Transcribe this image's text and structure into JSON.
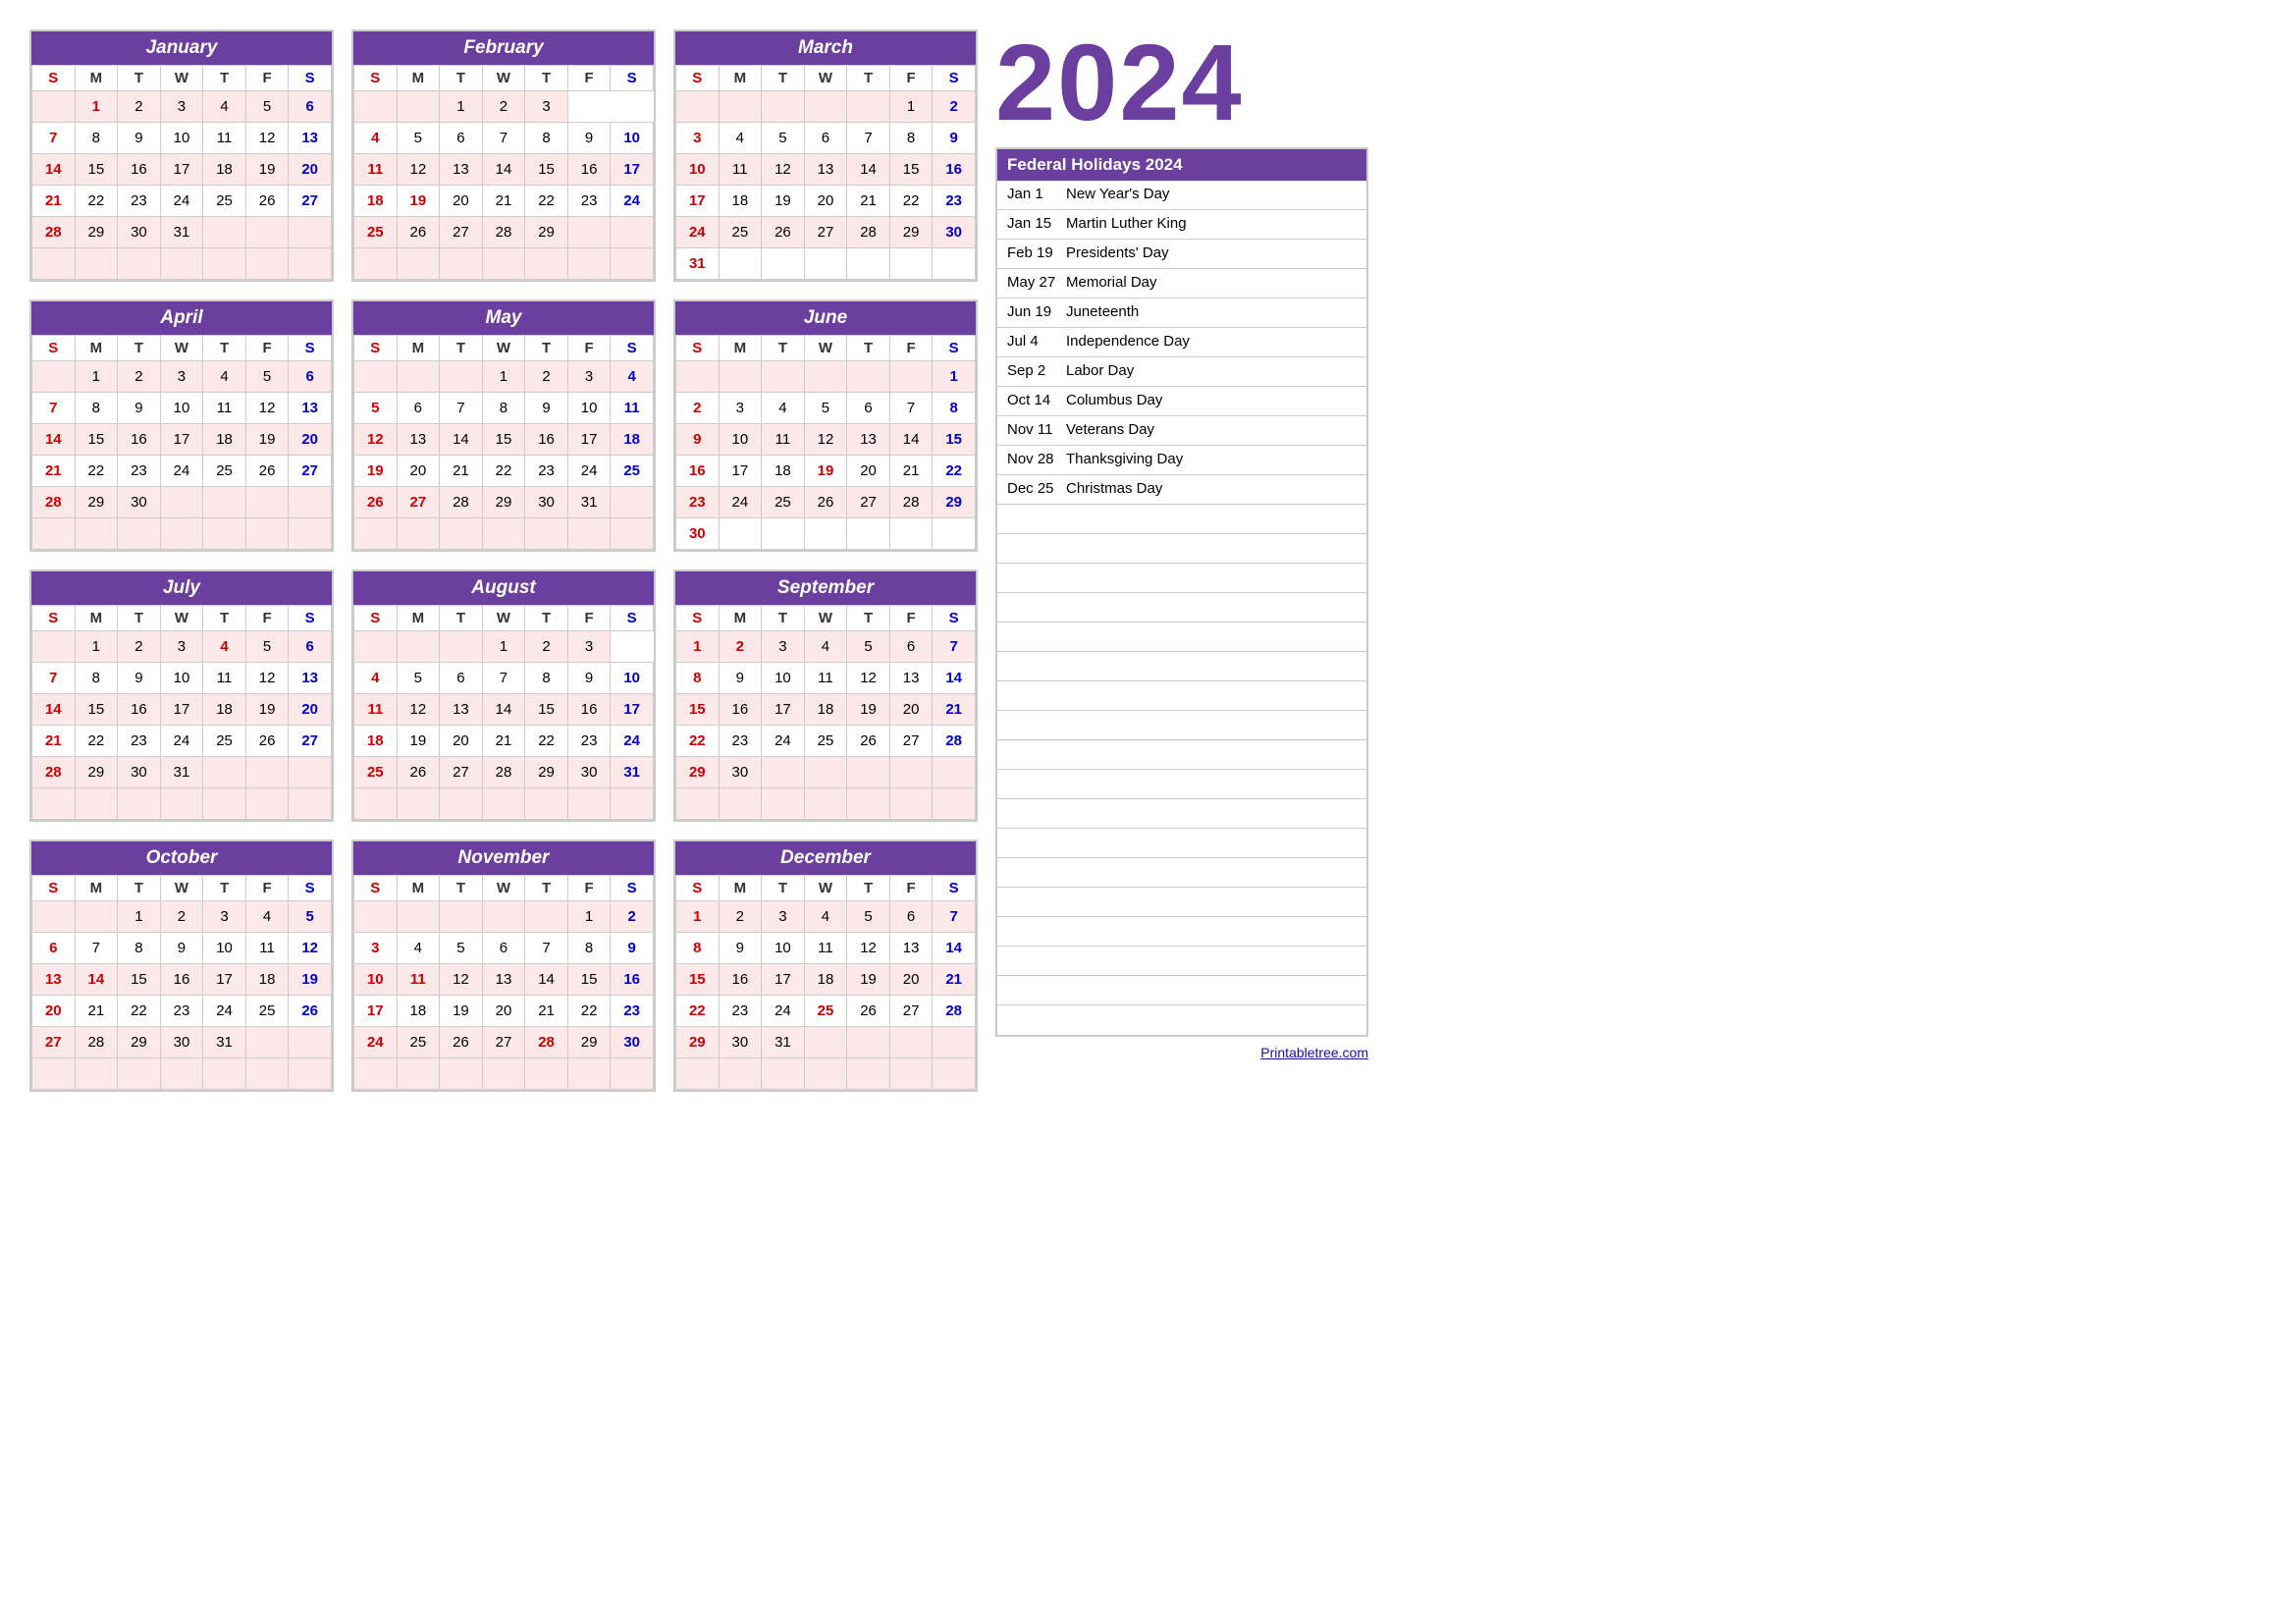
{
  "year": "2024",
  "holidays_header": "Federal Holidays 2024",
  "holidays": [
    {
      "date": "Jan 1",
      "name": "New Year's Day"
    },
    {
      "date": "Jan 15",
      "name": "Martin Luther King"
    },
    {
      "date": "Feb 19",
      "name": "Presidents' Day"
    },
    {
      "date": "May 27",
      "name": "Memorial Day"
    },
    {
      "date": "Jun 19",
      "name": "Juneteenth"
    },
    {
      "date": "Jul 4",
      "name": "Independence Day"
    },
    {
      "date": "Sep 2",
      "name": "Labor Day"
    },
    {
      "date": "Oct 14",
      "name": "Columbus Day"
    },
    {
      "date": "Nov 11",
      "name": "Veterans Day"
    },
    {
      "date": "Nov 28",
      "name": "Thanksgiving Day"
    },
    {
      "date": "Dec 25",
      "name": "Christmas Day"
    }
  ],
  "footer_link": "Printabletree.com",
  "months": [
    {
      "name": "January",
      "days": [
        [
          "",
          "1",
          "2",
          "3",
          "4",
          "5",
          "6"
        ],
        [
          "7",
          "8",
          "9",
          "10",
          "11",
          "12",
          "13"
        ],
        [
          "14",
          "15",
          "16",
          "17",
          "18",
          "19",
          "20"
        ],
        [
          "21",
          "22",
          "23",
          "24",
          "25",
          "26",
          "27"
        ],
        [
          "28",
          "29",
          "30",
          "31",
          "",
          "",
          ""
        ]
      ],
      "holidays": [
        "1"
      ]
    },
    {
      "name": "February",
      "days": [
        [
          "",
          "",
          "1",
          "2",
          "3"
        ],
        [
          "4",
          "5",
          "6",
          "7",
          "8",
          "9",
          "10"
        ],
        [
          "11",
          "12",
          "13",
          "14",
          "15",
          "16",
          "17"
        ],
        [
          "18",
          "19",
          "20",
          "21",
          "22",
          "23",
          "24"
        ],
        [
          "25",
          "26",
          "27",
          "28",
          "29",
          "",
          ""
        ]
      ],
      "holidays": [
        "19"
      ]
    },
    {
      "name": "March",
      "days": [
        [
          "",
          "",
          "",
          "",
          "",
          "1",
          "2"
        ],
        [
          "3",
          "4",
          "5",
          "6",
          "7",
          "8",
          "9"
        ],
        [
          "10",
          "11",
          "12",
          "13",
          "14",
          "15",
          "16"
        ],
        [
          "17",
          "18",
          "19",
          "20",
          "21",
          "22",
          "23"
        ],
        [
          "24",
          "25",
          "26",
          "27",
          "28",
          "29",
          "30"
        ],
        [
          "31",
          "",
          "",
          "",
          "",
          "",
          ""
        ]
      ],
      "holidays": []
    },
    {
      "name": "April",
      "days": [
        [
          "",
          "1",
          "2",
          "3",
          "4",
          "5",
          "6"
        ],
        [
          "7",
          "8",
          "9",
          "10",
          "11",
          "12",
          "13"
        ],
        [
          "14",
          "15",
          "16",
          "17",
          "18",
          "19",
          "20"
        ],
        [
          "21",
          "22",
          "23",
          "24",
          "25",
          "26",
          "27"
        ],
        [
          "28",
          "29",
          "30",
          "",
          "",
          "",
          ""
        ]
      ],
      "holidays": []
    },
    {
      "name": "May",
      "days": [
        [
          "",
          "",
          "",
          "1",
          "2",
          "3",
          "4"
        ],
        [
          "5",
          "6",
          "7",
          "8",
          "9",
          "10",
          "11"
        ],
        [
          "12",
          "13",
          "14",
          "15",
          "16",
          "17",
          "18"
        ],
        [
          "19",
          "20",
          "21",
          "22",
          "23",
          "24",
          "25"
        ],
        [
          "26",
          "27",
          "28",
          "29",
          "30",
          "31",
          ""
        ]
      ],
      "holidays": [
        "27"
      ]
    },
    {
      "name": "June",
      "days": [
        [
          "",
          "",
          "",
          "",
          "",
          "",
          "1"
        ],
        [
          "2",
          "3",
          "4",
          "5",
          "6",
          "7",
          "8"
        ],
        [
          "9",
          "10",
          "11",
          "12",
          "13",
          "14",
          "15"
        ],
        [
          "16",
          "17",
          "18",
          "19",
          "20",
          "21",
          "22"
        ],
        [
          "23",
          "24",
          "25",
          "26",
          "27",
          "28",
          "29"
        ],
        [
          "30",
          "",
          "",
          "",
          "",
          "",
          ""
        ]
      ],
      "holidays": [
        "19"
      ]
    },
    {
      "name": "July",
      "days": [
        [
          "",
          "1",
          "2",
          "3",
          "4",
          "5",
          "6"
        ],
        [
          "7",
          "8",
          "9",
          "10",
          "11",
          "12",
          "13"
        ],
        [
          "14",
          "15",
          "16",
          "17",
          "18",
          "19",
          "20"
        ],
        [
          "21",
          "22",
          "23",
          "24",
          "25",
          "26",
          "27"
        ],
        [
          "28",
          "29",
          "30",
          "31",
          "",
          "",
          ""
        ]
      ],
      "holidays": [
        "4"
      ]
    },
    {
      "name": "August",
      "days": [
        [
          "",
          "",
          "",
          "1",
          "2",
          "3"
        ],
        [
          "4",
          "5",
          "6",
          "7",
          "8",
          "9",
          "10"
        ],
        [
          "11",
          "12",
          "13",
          "14",
          "15",
          "16",
          "17"
        ],
        [
          "18",
          "19",
          "20",
          "21",
          "22",
          "23",
          "24"
        ],
        [
          "25",
          "26",
          "27",
          "28",
          "29",
          "30",
          "31"
        ]
      ],
      "holidays": []
    },
    {
      "name": "September",
      "days": [
        [
          "1",
          "2",
          "3",
          "4",
          "5",
          "6",
          "7"
        ],
        [
          "8",
          "9",
          "10",
          "11",
          "12",
          "13",
          "14"
        ],
        [
          "15",
          "16",
          "17",
          "18",
          "19",
          "20",
          "21"
        ],
        [
          "22",
          "23",
          "24",
          "25",
          "26",
          "27",
          "28"
        ],
        [
          "29",
          "30",
          "",
          "",
          "",
          "",
          ""
        ]
      ],
      "holidays": [
        "2"
      ]
    },
    {
      "name": "October",
      "days": [
        [
          "",
          "",
          "1",
          "2",
          "3",
          "4",
          "5"
        ],
        [
          "6",
          "7",
          "8",
          "9",
          "10",
          "11",
          "12"
        ],
        [
          "13",
          "14",
          "15",
          "16",
          "17",
          "18",
          "19"
        ],
        [
          "20",
          "21",
          "22",
          "23",
          "24",
          "25",
          "26"
        ],
        [
          "27",
          "28",
          "29",
          "30",
          "31",
          "",
          ""
        ]
      ],
      "holidays": [
        "14"
      ]
    },
    {
      "name": "November",
      "days": [
        [
          "",
          "",
          "",
          "",
          "",
          "1",
          "2"
        ],
        [
          "3",
          "4",
          "5",
          "6",
          "7",
          "8",
          "9"
        ],
        [
          "10",
          "11",
          "12",
          "13",
          "14",
          "15",
          "16"
        ],
        [
          "17",
          "18",
          "19",
          "20",
          "21",
          "22",
          "23"
        ],
        [
          "24",
          "25",
          "26",
          "27",
          "28",
          "29",
          "30"
        ]
      ],
      "holidays": [
        "11",
        "28"
      ]
    },
    {
      "name": "December",
      "days": [
        [
          "1",
          "2",
          "3",
          "4",
          "5",
          "6",
          "7"
        ],
        [
          "8",
          "9",
          "10",
          "11",
          "12",
          "13",
          "14"
        ],
        [
          "15",
          "16",
          "17",
          "18",
          "19",
          "20",
          "21"
        ],
        [
          "22",
          "23",
          "24",
          "25",
          "26",
          "27",
          "28"
        ],
        [
          "29",
          "30",
          "31",
          "",
          "",
          "",
          ""
        ]
      ],
      "holidays": [
        "25"
      ]
    }
  ],
  "day_headers": [
    "S",
    "M",
    "T",
    "W",
    "T",
    "F",
    "S"
  ]
}
